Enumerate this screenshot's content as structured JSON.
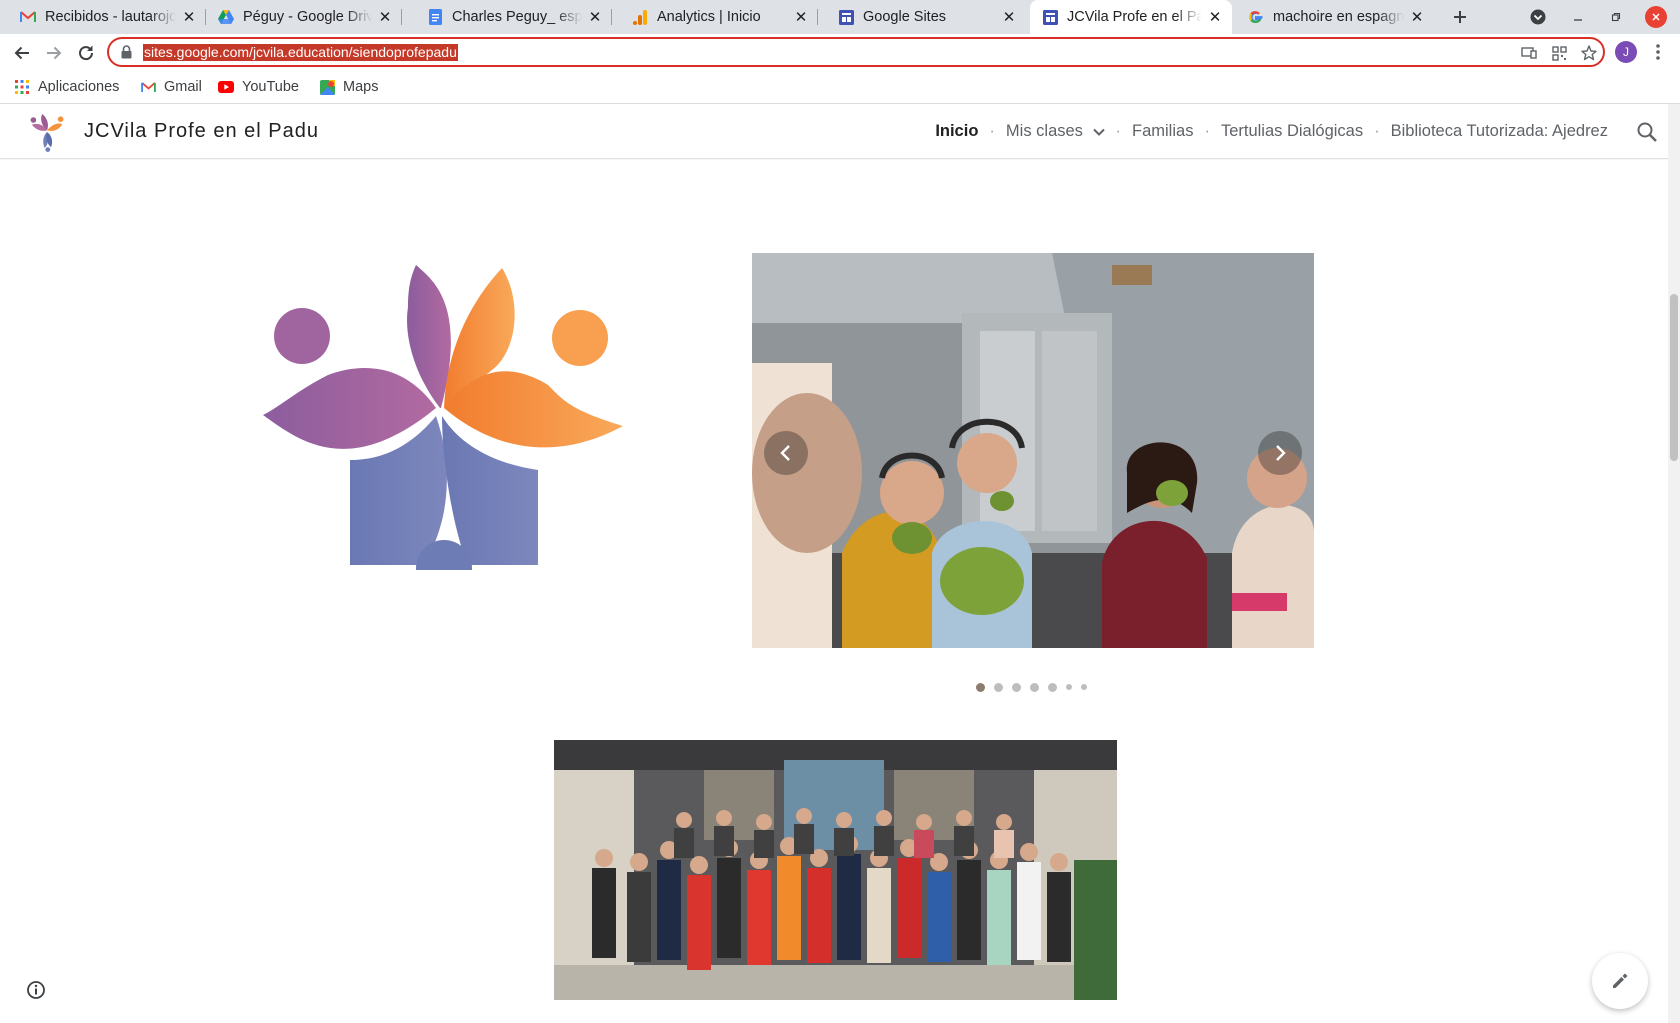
{
  "browser": {
    "tabs": [
      {
        "title": "Recibidos - lautarojc",
        "favicon": "gmail-icon"
      },
      {
        "title": "Péguy - Google Drive",
        "favicon": "drive-icon"
      },
      {
        "title": "Charles Peguy_ espe",
        "favicon": "docs-icon"
      },
      {
        "title": "Analytics | Inicio",
        "favicon": "analytics-icon"
      },
      {
        "title": "Google Sites",
        "favicon": "sites-icon"
      },
      {
        "title": "JCVila Profe en el Pa",
        "favicon": "sites-icon",
        "active": true
      },
      {
        "title": "machoire en espagn",
        "favicon": "google-icon"
      }
    ],
    "url": "sites.google.com/jcvila.education/siendoprofepadu",
    "profile_initial": "J",
    "bookmarks": [
      {
        "label": "Aplicaciones",
        "icon": "apps-grid-icon"
      },
      {
        "label": "Gmail",
        "icon": "gmail-icon"
      },
      {
        "label": "YouTube",
        "icon": "youtube-icon"
      },
      {
        "label": "Maps",
        "icon": "maps-icon"
      }
    ]
  },
  "site": {
    "title": "JCVila Profe en el Padu",
    "nav": {
      "inicio": "Inicio",
      "mis_clases": "Mis clases",
      "familias": "Familias",
      "tertulias": "Tertulias Dialógicas",
      "biblioteca": "Biblioteca Tutorizada: Ajedrez"
    },
    "separator": "·"
  },
  "content": {
    "carousel": {
      "slides": 7,
      "current": 1
    },
    "colors": {
      "purple": "#9b5c95",
      "orange": "#f5933c",
      "blue": "#6f7fb8",
      "active_dot": "#8d7b6b"
    }
  }
}
